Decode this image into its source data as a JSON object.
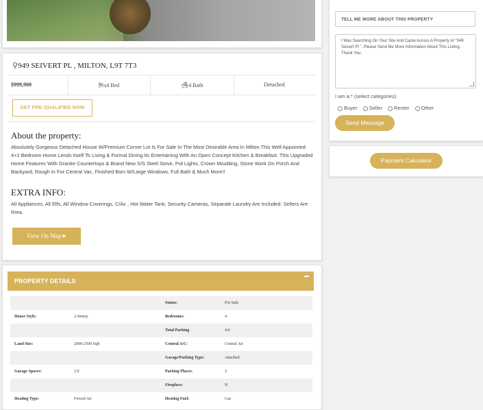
{
  "listing": {
    "address": "949 SEIVERT PL , MILTON, L9T 7T3",
    "price": "$999,900",
    "beds": "4 Bed",
    "baths": "4 Bath",
    "type": "Detached",
    "prequal_label": "GET PRE-QUALIFIED NOW",
    "about_heading": "About the property:",
    "about_text": "Absolutely Gorgeous Detached House W/Premium Corner Lot Is For Sale In The Most Desirable Area In Milton.This Well Appointed 4+2 Bedroom Home Lends Itself To Living & Formal Dining.Its Entertaining With An Open Concept Kitchen & Breakfast. This Upgraded Home Features With Granite Countertops & Brand New S/S Steel Stove, Pot Lights, Crown Moulding, Stone Work On Porch And Backyard, Rough In For Central Vac, Finished Bsm W/Large Windows, Full Bath & Much More!!",
    "extra_heading": "EXTRA INFO:",
    "extra_text": "All Appliances, All Elfs, All Window Coverings, C/Ac , Hot Water Tank, Security Cameras, Separate Laundry Are Included. Sellers Are Rrea.",
    "map_label": "View On Map"
  },
  "details": {
    "heading": "PROPERTY DETAILS",
    "rows": [
      {
        "k1": "",
        "v1": "",
        "k2": "Status:",
        "v2": "For  Sale"
      },
      {
        "k1": "House Style:",
        "v1": "2-Storey",
        "k2": "Bedrooms:",
        "v2": "4"
      },
      {
        "k1": "",
        "v1": "",
        "k2": "Total Parking",
        "v2": "4.0"
      },
      {
        "k1": "Land Size:",
        "v1": "2000-2500 Sqft",
        "k2": "Central A/C:",
        "v2": "Central Air"
      },
      {
        "k1": "",
        "v1": "",
        "k2": "Garage/Parking Type:",
        "v2": "Attached"
      },
      {
        "k1": "Garage Spaces:",
        "v1": "2.0",
        "k2": "Parking Places:",
        "v2": "2"
      },
      {
        "k1": "",
        "v1": "",
        "k2": "Fireplace:",
        "v2": "N"
      },
      {
        "k1": "Heating Type:",
        "v1": "Forced Air",
        "k2": "Heating Fuel:",
        "v2": "Gas"
      }
    ]
  },
  "contact": {
    "subject_value": "TELL ME MORE ABOUT THIS PROPERTY",
    "message_value": "I Was Searching On Your Site And Came Across A Property At \"949 Seivert Pl \". Please Send Me More Information About This Listing. Thank You.",
    "iam_label": "I am a:* (select categories)",
    "options": [
      "Buyer",
      "Seller",
      "Renter",
      "Other"
    ],
    "send_label": "Send Message"
  },
  "calculator": {
    "label": "Payment Calculator"
  },
  "colors": {
    "accent": "#d6b35a"
  },
  "icons": [
    "map-pin-icon",
    "bed-icon",
    "bath-icon",
    "navigation-arrow-icon",
    "minus-icon"
  ]
}
